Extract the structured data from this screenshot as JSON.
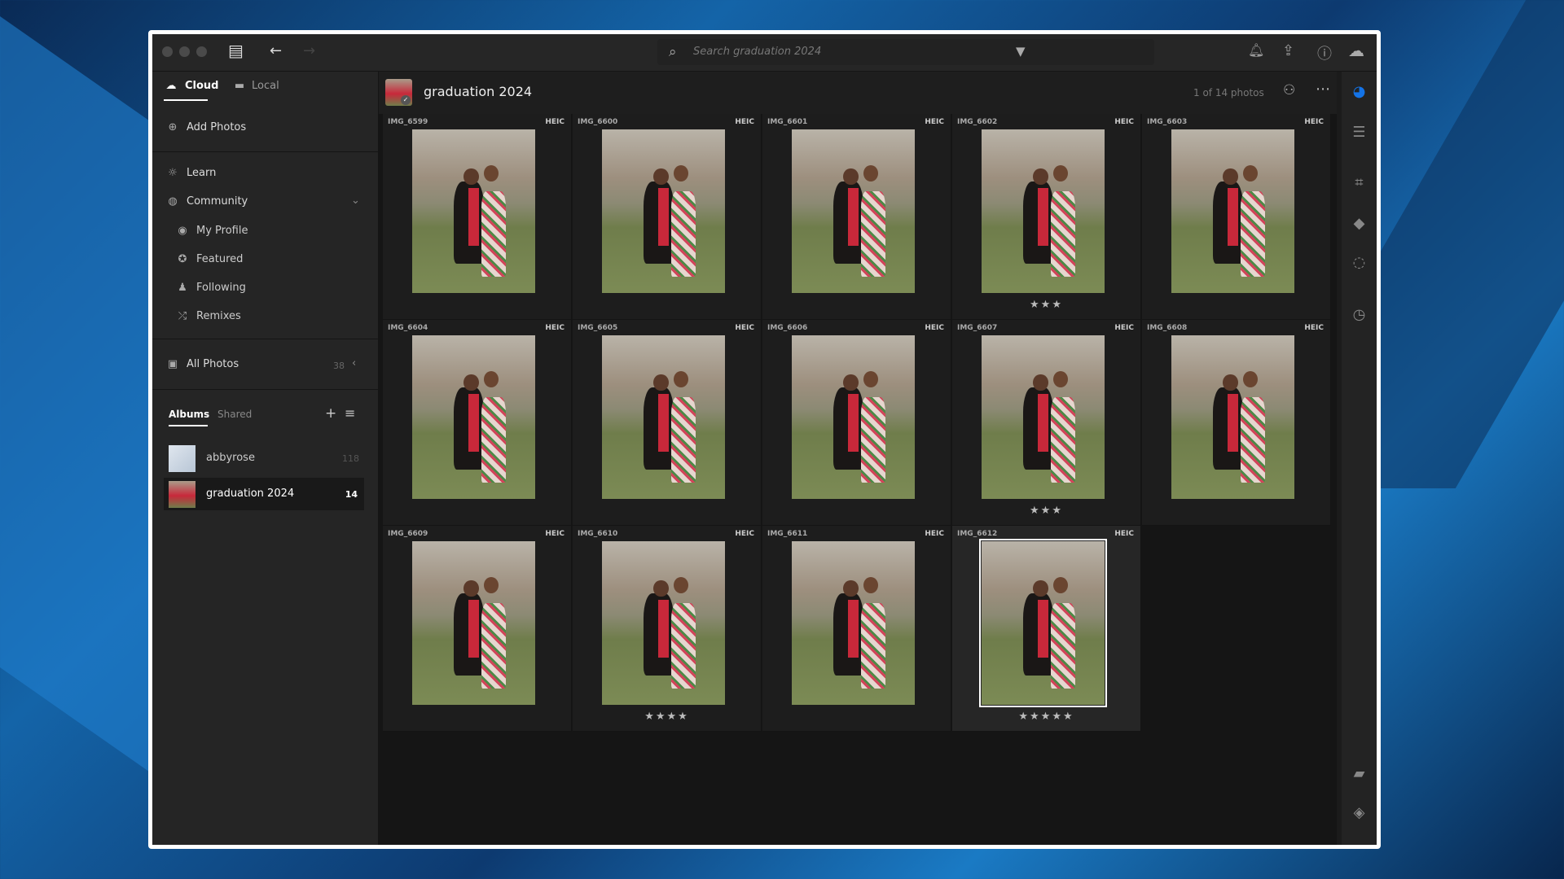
{
  "titlebar": {
    "search_placeholder": "Search graduation 2024"
  },
  "sidebar": {
    "tab_cloud": "Cloud",
    "tab_local": "Local",
    "add_photos": "Add Photos",
    "learn": "Learn",
    "community": "Community",
    "community_items": [
      "My Profile",
      "Featured",
      "Following",
      "Remixes"
    ],
    "all_photos": "All Photos",
    "all_photos_count": "38",
    "albums_tab": "Albums",
    "shared_tab": "Shared",
    "albums": [
      {
        "name": "abbyrose",
        "count": "118"
      },
      {
        "name": "graduation 2024",
        "count": "14"
      }
    ]
  },
  "main": {
    "album_title": "graduation 2024",
    "photo_count": "1 of 14 photos"
  },
  "photos": [
    {
      "name": "IMG_6599",
      "format": "HEIC",
      "rating": 0
    },
    {
      "name": "IMG_6600",
      "format": "HEIC",
      "rating": 0
    },
    {
      "name": "IMG_6601",
      "format": "HEIC",
      "rating": 0
    },
    {
      "name": "IMG_6602",
      "format": "HEIC",
      "rating": 3
    },
    {
      "name": "IMG_6603",
      "format": "HEIC",
      "rating": 0
    },
    {
      "name": "IMG_6604",
      "format": "HEIC",
      "rating": 0
    },
    {
      "name": "IMG_6605",
      "format": "HEIC",
      "rating": 0
    },
    {
      "name": "IMG_6606",
      "format": "HEIC",
      "rating": 0
    },
    {
      "name": "IMG_6607",
      "format": "HEIC",
      "rating": 3
    },
    {
      "name": "IMG_6608",
      "format": "HEIC",
      "rating": 0
    },
    {
      "name": "IMG_6609",
      "format": "HEIC",
      "rating": 0
    },
    {
      "name": "IMG_6610",
      "format": "HEIC",
      "rating": 4
    },
    {
      "name": "IMG_6611",
      "format": "HEIC",
      "rating": 0
    },
    {
      "name": "IMG_6612",
      "format": "HEIC",
      "rating": 5,
      "selected": true
    }
  ],
  "colors": {
    "accent": "#1473e6",
    "background": "#151515",
    "panel": "#252525"
  }
}
